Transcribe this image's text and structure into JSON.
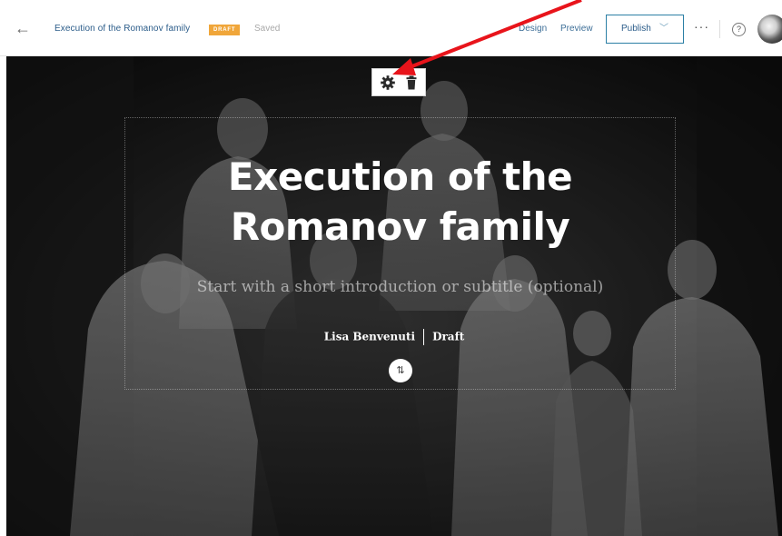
{
  "header": {
    "back_icon": "arrow-left-icon",
    "story_title": "Execution of the Romanov family",
    "status_badge": "DRAFT",
    "save_status": "Saved",
    "nav": {
      "design": "Design",
      "preview": "Preview"
    },
    "publish_label": "Publish",
    "more_label": "···",
    "help_label": "?"
  },
  "cover": {
    "title_line1": "Execution of the",
    "title_line2": "Romanov family",
    "subtitle_placeholder": "Start with a short introduction or subtitle (optional)",
    "author": "Lisa Benvenuti",
    "status": "Draft",
    "swap_label": "⇅"
  },
  "toolbar": {
    "icons": [
      "gear-icon",
      "trash-icon"
    ]
  },
  "colors": {
    "accent": "#2c5d8a",
    "badge": "#f0a63a",
    "annotation_arrow": "#e8141b"
  }
}
